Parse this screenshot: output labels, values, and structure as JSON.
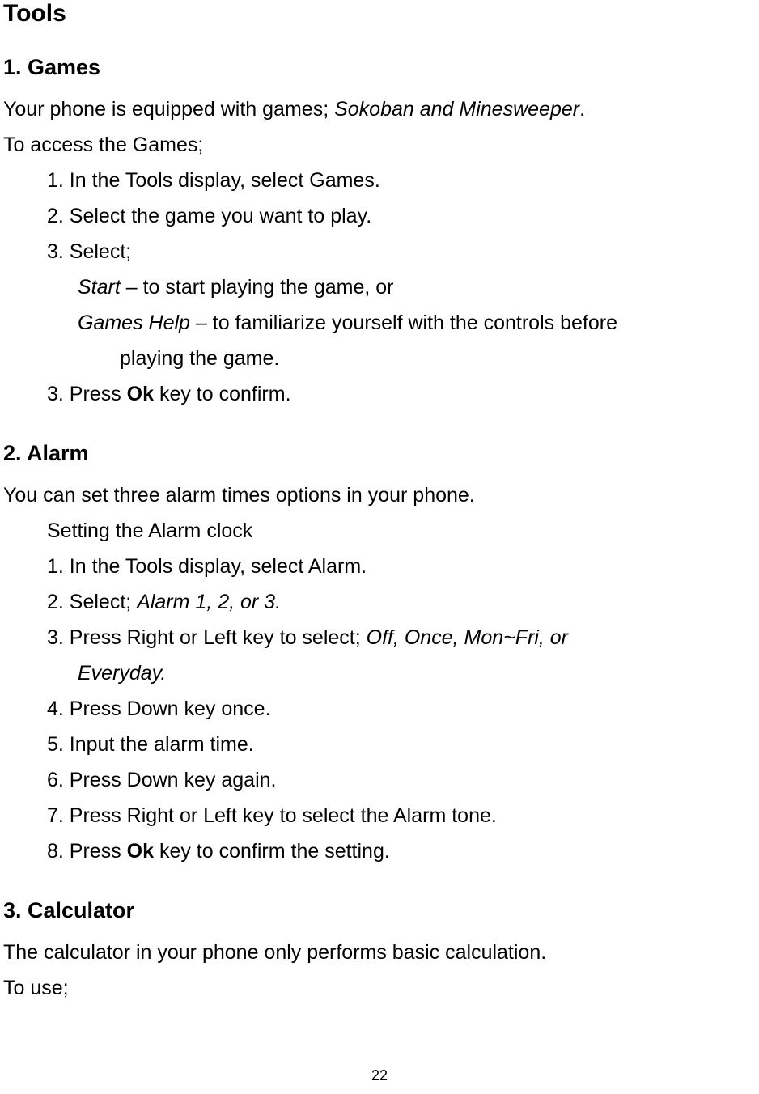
{
  "title": "Tools",
  "sections": {
    "games": {
      "heading": "1. Games",
      "intro1_a": "Your phone is equipped with games; ",
      "intro1_b": "Sokoban and Minesweeper",
      "intro1_c": ".",
      "intro2": "To access the Games;",
      "step1": "1. In the Tools display, select Games.",
      "step2": "2. Select the game you want to play.",
      "step3": "3. Select;",
      "sub1_a": "Start",
      "sub1_b": " – to start playing the game, or",
      "sub2_a": "Games Help",
      "sub2_b": " – to familiarize yourself with the controls before",
      "sub2_cont": "playing the game.",
      "step4_a": "3. Press ",
      "step4_b": "Ok",
      "step4_c": " key to confirm."
    },
    "alarm": {
      "heading": "2. Alarm",
      "intro": "You can set three alarm times options in your phone.",
      "subhead": "Setting the Alarm clock",
      "step1": "1. In the Tools display, select Alarm.",
      "step2_a": "2. Select; ",
      "step2_b": "Alarm 1, 2, or 3.",
      "step3_a": "3. Press Right or Left key to select; ",
      "step3_b": "Off, Once, Mon~Fri, or",
      "step3_cont": "Everyday.",
      "step4": "4. Press Down key once.",
      "step5": "5. Input the alarm time.",
      "step6": "6. Press Down key again.",
      "step7": "7. Press Right or Left key to select the Alarm tone.",
      "step8_a": "8. Press ",
      "step8_b": "Ok",
      "step8_c": " key to confirm the setting."
    },
    "calculator": {
      "heading": "3. Calculator",
      "intro1": "The calculator in your phone only performs basic calculation.",
      "intro2": "To use;"
    }
  },
  "page_number": "22"
}
